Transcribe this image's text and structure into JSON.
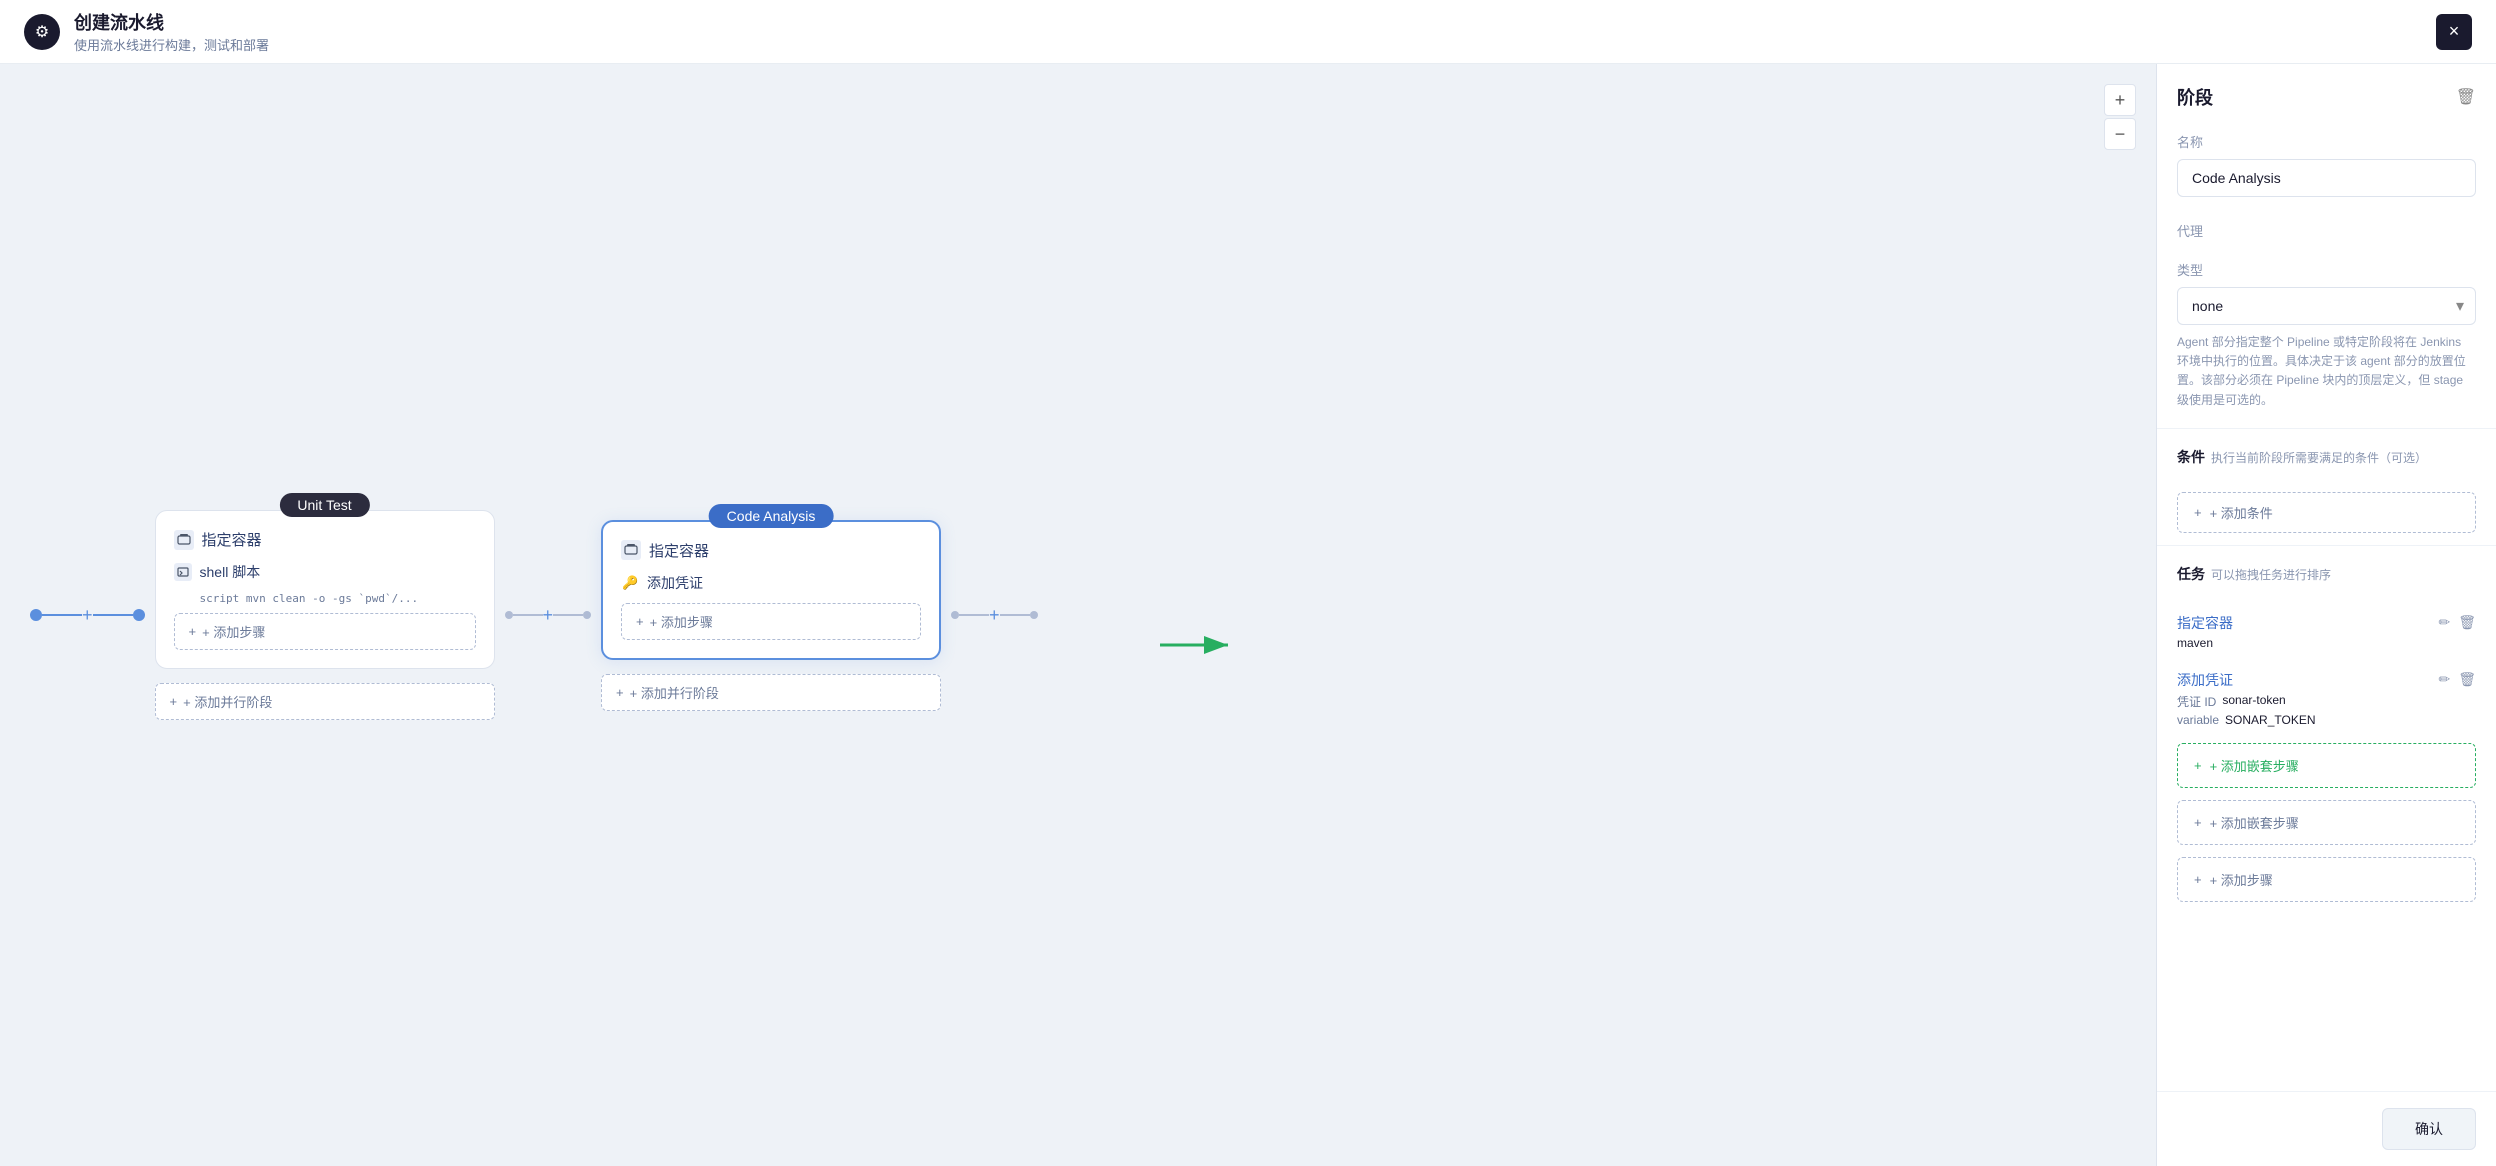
{
  "header": {
    "title": "创建流水线",
    "subtitle": "使用流水线进行构建，测试和部署",
    "close_label": "×",
    "logo_icon": "⚙"
  },
  "zoom_controls": {
    "plus_label": "+",
    "minus_label": "−"
  },
  "nodes": [
    {
      "id": "unit-test",
      "label": "Unit Test",
      "active": false,
      "sections": [
        {
          "type": "container",
          "label": "指定容器"
        }
      ],
      "steps": [
        {
          "type": "shell",
          "label": "shell 脚本",
          "code": "script  mvn clean -o -gs `pwd`/..."
        }
      ],
      "add_step_label": "+ 添加步骤",
      "add_parallel_label": "+ 添加并行阶段"
    },
    {
      "id": "code-analysis",
      "label": "Code Analysis",
      "active": true,
      "sections": [
        {
          "type": "container",
          "label": "指定容器"
        }
      ],
      "steps": [
        {
          "type": "credential",
          "label": "添加凭证"
        }
      ],
      "add_step_label": "+ 添加步骤",
      "add_parallel_label": "+ 添加并行阶段"
    }
  ],
  "right_panel": {
    "title": "阶段",
    "name_label": "名称",
    "name_value": "Code Analysis",
    "agent_label": "代理",
    "agent_type_label": "类型",
    "agent_type_value": "none",
    "agent_desc": "Agent 部分指定整个 Pipeline 或特定阶段将在 Jenkins 环境中执行的位置。具体决定于该 agent 部分的放置位置。该部分必须在 Pipeline 块内的顶层定义，但 stage 级使用是可选的。",
    "conditions_label": "条件",
    "conditions_sub": "执行当前阶段所需要满足的条件（可选）",
    "add_condition_label": "+ 添加条件",
    "tasks_label": "任务",
    "tasks_sub": "可以拖拽任务进行排序",
    "task_items": [
      {
        "title": "指定容器",
        "detail_label1": "",
        "detail_value1": "maven"
      },
      {
        "title": "添加凭证",
        "detail_label1": "凭证 ID",
        "detail_value1": "sonar-token",
        "detail_label2": "variable",
        "detail_value2": "SONAR_TOKEN"
      }
    ],
    "add_nested_label": "+ 添加嵌套步骤",
    "add_nested_label2": "+ 添加嵌套步骤",
    "add_step_label": "+ 添加步骤",
    "confirm_label": "确认"
  }
}
